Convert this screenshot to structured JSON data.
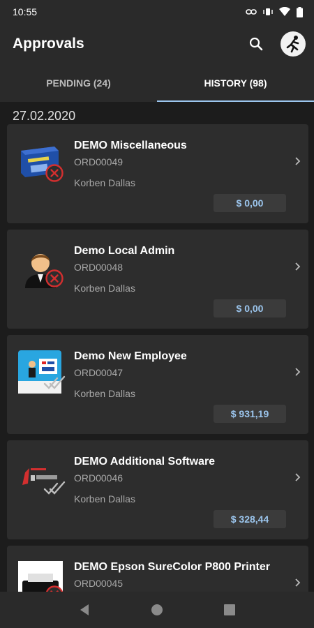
{
  "status_bar": {
    "time": "10:55"
  },
  "app_bar": {
    "title": "Approvals"
  },
  "tabs": [
    {
      "label": "PENDING (24)",
      "active": false
    },
    {
      "label": "HISTORY (98)",
      "active": true
    }
  ],
  "history": {
    "date": "27.02.2020",
    "items": [
      {
        "name": "DEMO Miscellaneous",
        "order": "ORD00049",
        "person": "Korben Dallas",
        "amount": "$ 0,00",
        "status": "rejected",
        "thumb": "miscellaneous-box-icon"
      },
      {
        "name": "Demo Local Admin",
        "order": "ORD00048",
        "person": "Korben Dallas",
        "amount": "$ 0,00",
        "status": "rejected",
        "thumb": "admin-user-icon"
      },
      {
        "name": "Demo New Employee",
        "order": "ORD00047",
        "person": "Korben Dallas",
        "amount": "$ 931,19",
        "status": "approved",
        "thumb": "new-employee-icon"
      },
      {
        "name": "DEMO Additional Software",
        "order": "ORD00046",
        "person": "Korben Dallas",
        "amount": "$ 328,44",
        "status": "approved",
        "thumb": "jmeter-logo-icon"
      },
      {
        "name": "DEMO Epson SureColor P800 Printer",
        "order": "ORD00045",
        "person": "",
        "amount": "",
        "status": "rejected",
        "thumb": "printer-icon"
      }
    ]
  },
  "colors": {
    "accent": "#9cc6ee",
    "reject": "#d32f2f",
    "background": "#1c1c1c",
    "card": "#2d2d2d"
  }
}
